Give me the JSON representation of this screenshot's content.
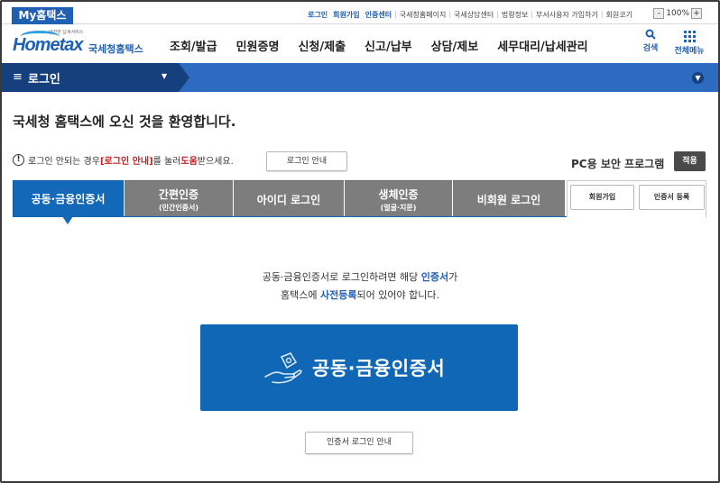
{
  "topbar": {
    "my_tab": "My홈택스",
    "links": [
      "로그인",
      "회원가입",
      "인증센터",
      "국세청홈페이지",
      "국세상담센터",
      "법령정보",
      "부서사용자 가입하기",
      "회원코기"
    ],
    "zoom": "100%",
    "zoom_out": "-",
    "zoom_in": "+"
  },
  "header": {
    "logo_small": "안전한 납세서비스",
    "logo_text": "Hometax",
    "logo_kr": "국세청홈택스",
    "menu": [
      "조회/발급",
      "민원증명",
      "신청/제출",
      "신고/납부",
      "상담/제보",
      "세무대리/납세관리"
    ],
    "search_label": "검색",
    "allmenu_label": "전체메뉴"
  },
  "bluebar": {
    "location": "로그인"
  },
  "main": {
    "welcome": "국세청 홈택스에 오신 것을 환영합니다.",
    "notice_pre": "로그인 안되는 경우 ",
    "notice_link": "[로그인 안내]",
    "notice_mid": "를 눌러 ",
    "notice_help": "도움",
    "notice_post": "받으세요.",
    "guide_button": "로그인 안내",
    "pc_security": "PC용 보안 프로그램",
    "apply_button": "적용",
    "tabs": [
      {
        "label": "공동·금융인증서",
        "sub": ""
      },
      {
        "label": "간편인증",
        "sub": "(민간인증서)"
      },
      {
        "label": "아이디 로그인",
        "sub": ""
      },
      {
        "label": "생체인증",
        "sub": "(얼굴·지문)"
      },
      {
        "label": "비회원 로그인",
        "sub": ""
      }
    ],
    "signup_button": "회원가입",
    "cert_register_button": "인증서 등록",
    "msg_line1_pre": "공동·금융인증서로 로그인하려면 해당 ",
    "msg_line1_blue": "인증서",
    "msg_line1_post": "가",
    "msg_line2_pre": "홈택스에 ",
    "msg_line2_blue": "사전등록",
    "msg_line2_post": "되어 있어야 합니다.",
    "cert_button": "공동·금융인증서",
    "cert_guide_button": "인증서 로그인 안내"
  },
  "colors": {
    "brand_blue": "#1468b8",
    "nav_dark": "#163f7e",
    "nav_bar": "#2d6bc0",
    "tab_gray": "#7d7d7d",
    "alert_red": "#c41e1e"
  }
}
